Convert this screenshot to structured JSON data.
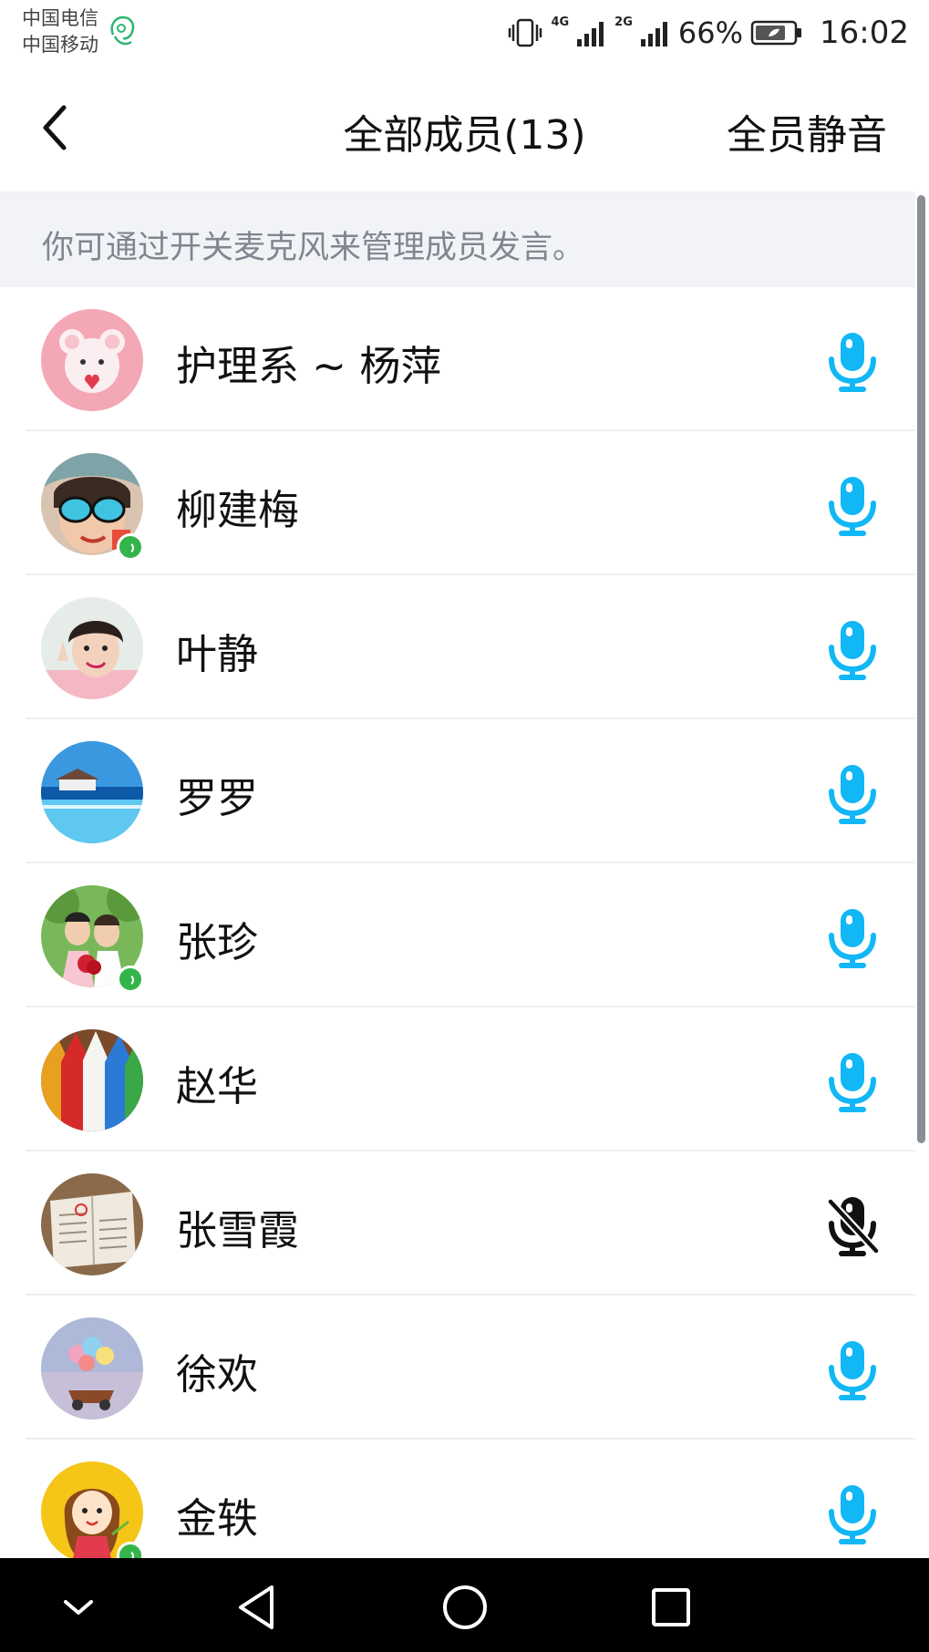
{
  "status_bar": {
    "carrier_1": "中国电信",
    "carrier_2": "中国移动",
    "network_1": "4G",
    "network_2": "2G",
    "battery_percent": "66%",
    "time": "16:02",
    "icons": [
      "headset-icon",
      "vibrate-icon",
      "signal-icon",
      "signal-icon",
      "battery-icon"
    ]
  },
  "header": {
    "title": "全部成员(13)",
    "mute_all_label": "全员静音",
    "back_icon": "chevron-left-icon"
  },
  "notice": {
    "text": "你可通过开关麦克风来管理成员发言。"
  },
  "members": [
    {
      "name": "护理系 ~ 杨萍",
      "mic": "on",
      "speaking": false
    },
    {
      "name": "柳建梅",
      "mic": "on",
      "speaking": true
    },
    {
      "name": "叶静",
      "mic": "on",
      "speaking": false
    },
    {
      "name": "罗罗",
      "mic": "on",
      "speaking": false
    },
    {
      "name": "张珍",
      "mic": "on",
      "speaking": true
    },
    {
      "name": "赵华",
      "mic": "on",
      "speaking": false
    },
    {
      "name": "张雪霞",
      "mic": "off",
      "speaking": false
    },
    {
      "name": "徐欢",
      "mic": "on",
      "speaking": false
    },
    {
      "name": "金轶",
      "mic": "on",
      "speaking": true
    }
  ],
  "colors": {
    "mic_on": "#12b7f5",
    "mic_off": "#111111",
    "speaking_badge": "#33b54a",
    "notice_bg": "#f1f3f7",
    "notice_text": "#808690"
  },
  "nav": {
    "buttons": [
      "collapse-icon",
      "back-triangle-icon",
      "home-circle-icon",
      "recents-square-icon"
    ]
  }
}
